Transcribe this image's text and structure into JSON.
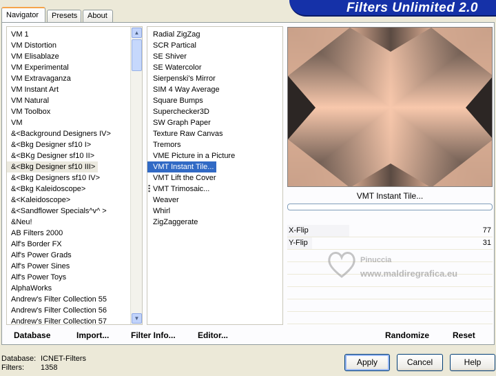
{
  "app": {
    "title": "Filters Unlimited 2.0"
  },
  "tabs": [
    {
      "label": "Navigator"
    },
    {
      "label": "Presets"
    },
    {
      "label": "About"
    }
  ],
  "categories": {
    "items": [
      "VM 1",
      "VM Distortion",
      "VM Elisablaze",
      "VM Experimental",
      "VM Extravaganza",
      "VM Instant Art",
      "VM Natural",
      "VM Toolbox",
      "VM",
      "&<Background Designers IV>",
      "&<Bkg Designer sf10 I>",
      "&<BKg Designer sf10 II>",
      "&<Bkg Designer sf10 III>",
      "&<Bkg Designers sf10 IV>",
      "&<Bkg Kaleidoscope>",
      "&<Kaleidoscope>",
      "&<Sandflower Specials^v^ >",
      "&Neu!",
      "AB Filters 2000",
      "Alf's Border FX",
      "Alf's Power Grads",
      "Alf's Power Sines",
      "Alf's Power Toys",
      "AlphaWorks",
      "Andrew's Filter Collection 55",
      "Andrew's Filter Collection 56",
      "Andrew's Filter Collection 57"
    ]
  },
  "filters": {
    "items": [
      "Radial ZigZag",
      "SCR  Partical",
      "SE Shiver",
      "SE Watercolor",
      "Sierpenski's Mirror",
      "SIM 4 Way Average",
      "Square Bumps",
      "Superchecker3D",
      "SW Graph Paper",
      "Texture Raw Canvas",
      "Tremors",
      "VME Picture in a Picture",
      "VMT Instant Tile...",
      "VMT Lift the Cover",
      "VMT Trimosaic...",
      "Weaver",
      "Whirl",
      "ZigZaggerate"
    ]
  },
  "bottom_bar": {
    "database": "Database",
    "import": "Import...",
    "filter_info": "Filter Info...",
    "editor": "Editor...",
    "randomize": "Randomize",
    "reset": "Reset"
  },
  "preview": {
    "label": "VMT Instant Tile..."
  },
  "params": [
    {
      "label": "X-Flip",
      "value": "77",
      "fraction": 0.302
    },
    {
      "label": "Y-Flip",
      "value": "31",
      "fraction": 0.122
    }
  ],
  "status": {
    "database_key": "Database:",
    "database_value": "ICNET-Filters",
    "filters_key": "Filters:",
    "filters_value": "1358"
  },
  "buttons": {
    "apply": "Apply",
    "cancel": "Cancel",
    "help": "Help"
  },
  "watermark": {
    "line1": "Pinuccia",
    "line2": "www.maldiregrafica.eu"
  }
}
